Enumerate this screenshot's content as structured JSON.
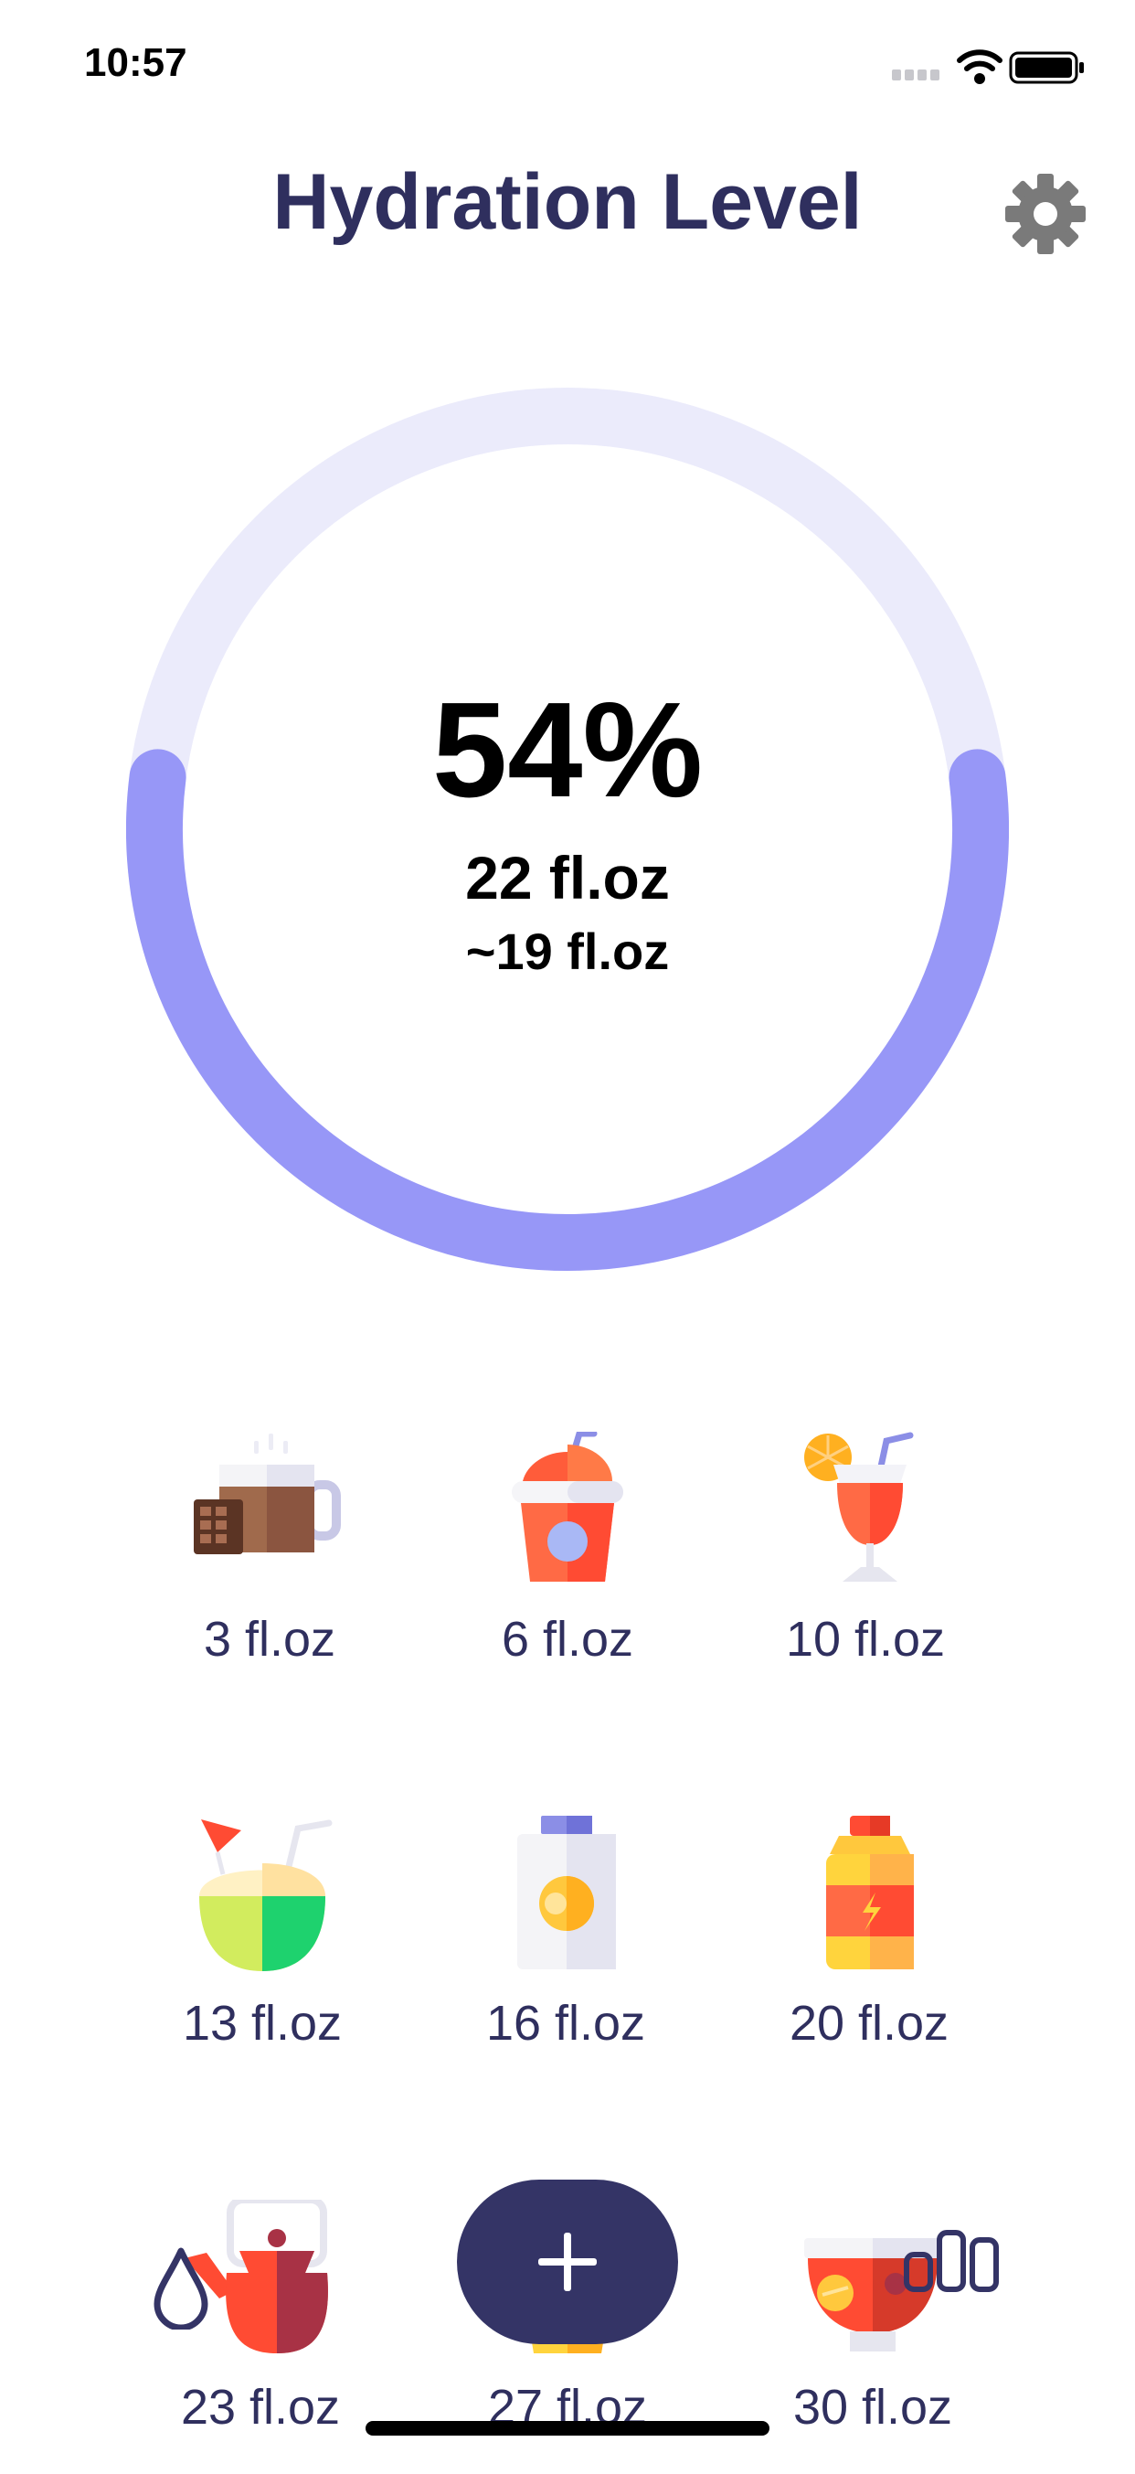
{
  "status_bar": {
    "time": "10:57"
  },
  "header": {
    "title": "Hydration Level"
  },
  "progress": {
    "percent_label": "54%",
    "consumed_label": "22 fl.oz",
    "goal_label": "~19 fl.oz",
    "fill_fraction": 0.54,
    "track_color": "#ebebfb",
    "fill_color": "#9797f7"
  },
  "drinks": [
    {
      "label": "3 fl.oz",
      "icon": "hot-chocolate-mug-icon"
    },
    {
      "label": "6 fl.oz",
      "icon": "smoothie-cup-icon"
    },
    {
      "label": "10 fl.oz",
      "icon": "cocktail-glass-icon"
    },
    {
      "label": "13 fl.oz",
      "icon": "coconut-drink-icon"
    },
    {
      "label": "16 fl.oz",
      "icon": "juice-carton-icon"
    },
    {
      "label": "20 fl.oz",
      "icon": "energy-drink-bottle-icon"
    },
    {
      "label": "23 fl.oz",
      "icon": "teapot-icon"
    },
    {
      "label": "27 fl.oz",
      "icon": "cup-icon"
    },
    {
      "label": "30 fl.oz",
      "icon": "punch-bowl-icon"
    }
  ],
  "tab_bar": {
    "left_icon": "water-drop-icon",
    "center_icon": "plus-icon",
    "right_icon": "stats-bars-icon",
    "accent": "#343466"
  }
}
